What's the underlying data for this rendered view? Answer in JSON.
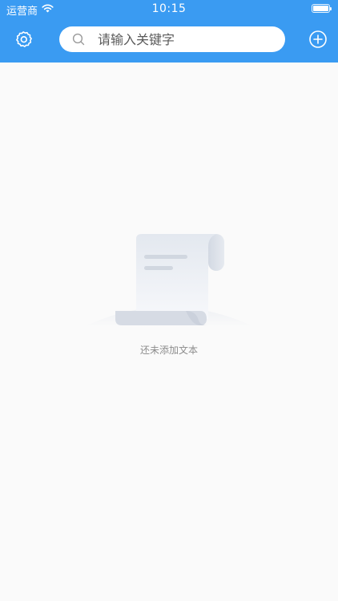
{
  "status_bar": {
    "carrier": "运营商",
    "time": "10:15"
  },
  "toolbar": {
    "settings_icon": "gear-icon",
    "add_icon": "plus-circle-icon"
  },
  "search": {
    "placeholder": "请输入关键字",
    "value": "",
    "icon": "search-icon"
  },
  "empty_state": {
    "message": "还未添加文本",
    "icon": "document-scroll-illustration"
  },
  "colors": {
    "header_bg": "#3a9bf2",
    "page_bg": "#fafafa",
    "empty_text": "#8c8c8c"
  }
}
